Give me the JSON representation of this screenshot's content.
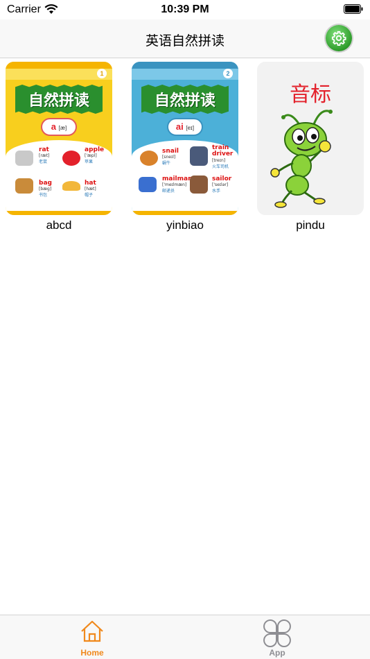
{
  "status_bar": {
    "carrier": "Carrier",
    "time": "10:39 PM"
  },
  "nav": {
    "title": "英语自然拼读",
    "settings_icon": "gear-icon"
  },
  "cards": [
    {
      "label": "abcd",
      "badge": "1",
      "banner": "自然拼读",
      "pill_letter": "a",
      "pill_ipa": "[æ]",
      "words": [
        {
          "word": "rat",
          "ipa": "[ræt]",
          "cn": "老鼠"
        },
        {
          "word": "apple",
          "ipa": "['æpl]",
          "cn": "苹果"
        },
        {
          "word": "bag",
          "ipa": "[bæg]",
          "cn": "书包"
        },
        {
          "word": "hat",
          "ipa": "[hæt]",
          "cn": "帽子"
        }
      ]
    },
    {
      "label": "yinbiao",
      "badge": "2",
      "banner": "自然拼读",
      "pill_letter": "ai",
      "pill_ipa": "[eɪ]",
      "words": [
        {
          "word": "snail",
          "ipa": "[sneɪl]",
          "cn": "蜗牛"
        },
        {
          "word": "train driver",
          "ipa": "[treɪn]",
          "cn": "火车司机"
        },
        {
          "word": "mailman",
          "ipa": "['meɪlmæn]",
          "cn": "邮递员"
        },
        {
          "word": "sailor",
          "ipa": "['seɪlər]",
          "cn": "水手"
        }
      ]
    },
    {
      "label": "pindu",
      "title": "音标"
    }
  ],
  "tabs": [
    {
      "label": "Home",
      "icon": "home-icon",
      "active": true
    },
    {
      "label": "App",
      "icon": "apps-icon",
      "active": false
    }
  ],
  "colors": {
    "active_tab": "#f0891c",
    "inactive_tab": "#8e8e93",
    "accent_green": "#2e9c2b"
  }
}
